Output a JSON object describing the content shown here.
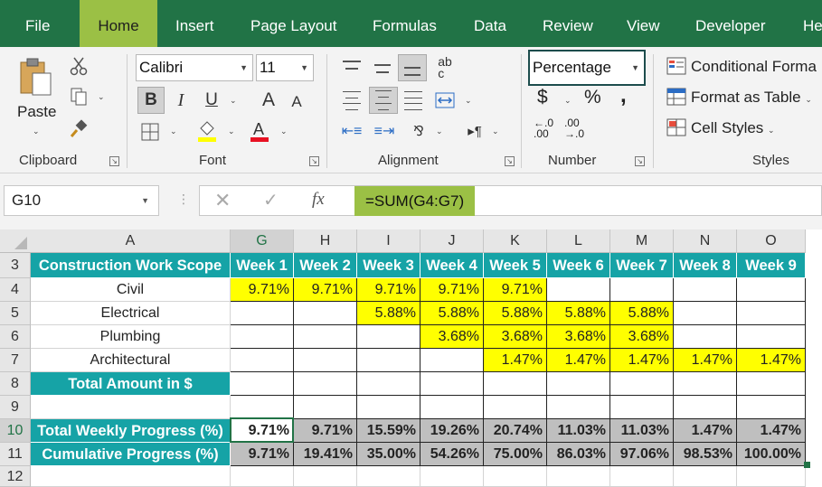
{
  "tabs": [
    {
      "label": "File",
      "active": false
    },
    {
      "label": "Home",
      "active": true
    },
    {
      "label": "Insert",
      "active": false
    },
    {
      "label": "Page Layout",
      "active": false
    },
    {
      "label": "Formulas",
      "active": false
    },
    {
      "label": "Data",
      "active": false
    },
    {
      "label": "Review",
      "active": false
    },
    {
      "label": "View",
      "active": false
    },
    {
      "label": "Developer",
      "active": false
    },
    {
      "label": "He",
      "active": false
    }
  ],
  "ribbon": {
    "clipboard": {
      "paste_label": "Paste",
      "group_label": "Clipboard"
    },
    "font": {
      "font_name": "Calibri",
      "font_size": "11",
      "bold": "B",
      "italic": "I",
      "underline": "U",
      "grow": "A",
      "shrink": "A",
      "group_label": "Font"
    },
    "alignment": {
      "group_label": "Alignment"
    },
    "number": {
      "format": "Percentage",
      "currency": "$",
      "percent": "%",
      "comma": ",",
      "inc_dec_top": "←.0",
      "inc_dec_bottom": ".00",
      "dec_dec_top": ".00",
      "dec_dec_bottom": "→.0",
      "group_label": "Number"
    },
    "styles": {
      "conditional": "Conditional Forma",
      "format_table": "Format as Table",
      "cell_styles": "Cell Styles",
      "group_label": "Styles"
    }
  },
  "formula_bar": {
    "name_box": "G10",
    "fx": "fx",
    "formula": "=SUM(G4:G7)"
  },
  "columns": [
    "A",
    "G",
    "H",
    "I",
    "J",
    "K",
    "L",
    "M",
    "N",
    "O"
  ],
  "selected_column": "G",
  "rows": [
    {
      "num": "3",
      "cells": [
        "Construction Work Scope",
        "Week 1",
        "Week 2",
        "Week 3",
        "Week 4",
        "Week 5",
        "Week 6",
        "Week 7",
        "Week 8",
        "Week 9"
      ]
    },
    {
      "num": "4",
      "cells": [
        "Civil",
        "9.71%",
        "9.71%",
        "9.71%",
        "9.71%",
        "9.71%",
        "",
        "",
        "",
        ""
      ]
    },
    {
      "num": "5",
      "cells": [
        "Electrical",
        "",
        "",
        "5.88%",
        "5.88%",
        "5.88%",
        "5.88%",
        "5.88%",
        "",
        ""
      ]
    },
    {
      "num": "6",
      "cells": [
        "Plumbing",
        "",
        "",
        "",
        "3.68%",
        "3.68%",
        "3.68%",
        "3.68%",
        "",
        ""
      ]
    },
    {
      "num": "7",
      "cells": [
        "Architectural",
        "",
        "",
        "",
        "",
        "1.47%",
        "1.47%",
        "1.47%",
        "1.47%",
        "1.47%"
      ]
    },
    {
      "num": "8",
      "cells": [
        "Total Amount in $",
        "",
        "",
        "",
        "",
        "",
        "",
        "",
        "",
        ""
      ]
    },
    {
      "num": "9",
      "cells": [
        "",
        "",
        "",
        "",
        "",
        "",
        "",
        "",
        "",
        ""
      ]
    },
    {
      "num": "10",
      "cells": [
        "Total Weekly Progress (%)",
        "9.71%",
        "9.71%",
        "15.59%",
        "19.26%",
        "20.74%",
        "11.03%",
        "11.03%",
        "1.47%",
        "1.47%"
      ]
    },
    {
      "num": "11",
      "cells": [
        "Cumulative Progress (%)",
        "9.71%",
        "19.41%",
        "35.00%",
        "54.26%",
        "75.00%",
        "86.03%",
        "97.06%",
        "98.53%",
        "100.00%"
      ]
    },
    {
      "num": "12",
      "cells": [
        "",
        "",
        "",
        "",
        "",
        "",
        "",
        "",
        "",
        ""
      ]
    }
  ],
  "selected_row": "10",
  "colors": {
    "excel_green": "#217346",
    "active_tab": "#9bc045",
    "teal_header": "#16a3a6",
    "highlight": "#ffff00",
    "total_grey": "#bfbfbf"
  }
}
